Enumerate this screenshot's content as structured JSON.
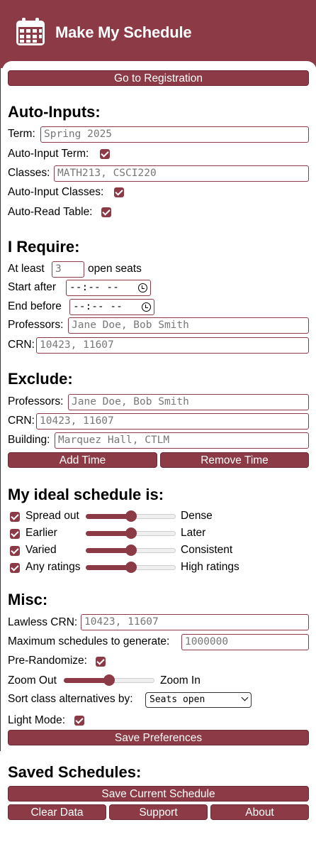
{
  "header": {
    "title": "Make My Schedule",
    "icon": "calendar-icon"
  },
  "top": {
    "go_registration": "Go to Registration"
  },
  "auto_inputs": {
    "heading": "Auto-Inputs:",
    "term_label": "Term:",
    "term_placeholder": "Spring 2025",
    "auto_term_label": "Auto-Input Term:",
    "auto_term_checked": true,
    "classes_label": "Classes:",
    "classes_placeholder": "MATH213, CSCI220",
    "auto_classes_label": "Auto-Input Classes:",
    "auto_classes_checked": true,
    "auto_read_label": "Auto-Read Table:",
    "auto_read_checked": true
  },
  "require": {
    "heading": "I Require:",
    "at_least_label": "At least",
    "seats_placeholder": "3",
    "open_seats_label": "open seats",
    "start_after_label": "Start after",
    "start_after_value": "--:-- --",
    "end_before_label": "End before",
    "end_before_value": "--:-- --",
    "professors_label": "Professors:",
    "professors_placeholder": "Jane Doe, Bob Smith",
    "crn_label": "CRN:",
    "crn_placeholder": "10423, 11607"
  },
  "exclude": {
    "heading": "Exclude:",
    "professors_label": "Professors:",
    "professors_placeholder": "Jane Doe, Bob Smith",
    "crn_label": "CRN:",
    "crn_placeholder": "10423, 11607",
    "building_label": "Building:",
    "building_placeholder": "Marquez Hall, CTLM",
    "add_time": "Add Time",
    "remove_time": "Remove Time"
  },
  "ideal": {
    "heading": "My ideal schedule is:",
    "rows": [
      {
        "left": "Spread out",
        "right": "Dense",
        "checked": true,
        "value": 0.5
      },
      {
        "left": "Earlier",
        "right": "Later",
        "checked": true,
        "value": 0.5
      },
      {
        "left": "Varied",
        "right": "Consistent",
        "checked": true,
        "value": 0.5
      },
      {
        "left": "Any ratings",
        "right": "High ratings",
        "checked": true,
        "value": 0.5
      }
    ]
  },
  "misc": {
    "heading": "Misc:",
    "lawless_label": "Lawless CRN:",
    "lawless_placeholder": "10423, 11607",
    "max_label": "Maximum schedules to generate:",
    "max_placeholder": "1000000",
    "prerandom_label": "Pre-Randomize:",
    "prerandom_checked": true,
    "zoom_out": "Zoom Out",
    "zoom_in": "Zoom In",
    "zoom_value": 0.5,
    "sort_label": "Sort class alternatives by:",
    "sort_value": "Seats open",
    "light_label": "Light Mode:",
    "light_checked": true,
    "save_prefs": "Save Preferences"
  },
  "saved": {
    "heading": "Saved Schedules:",
    "save_current": "Save Current Schedule",
    "clear": "Clear Data",
    "support": "Support",
    "about": "About"
  },
  "colors": {
    "accent": "#8c3a46"
  }
}
